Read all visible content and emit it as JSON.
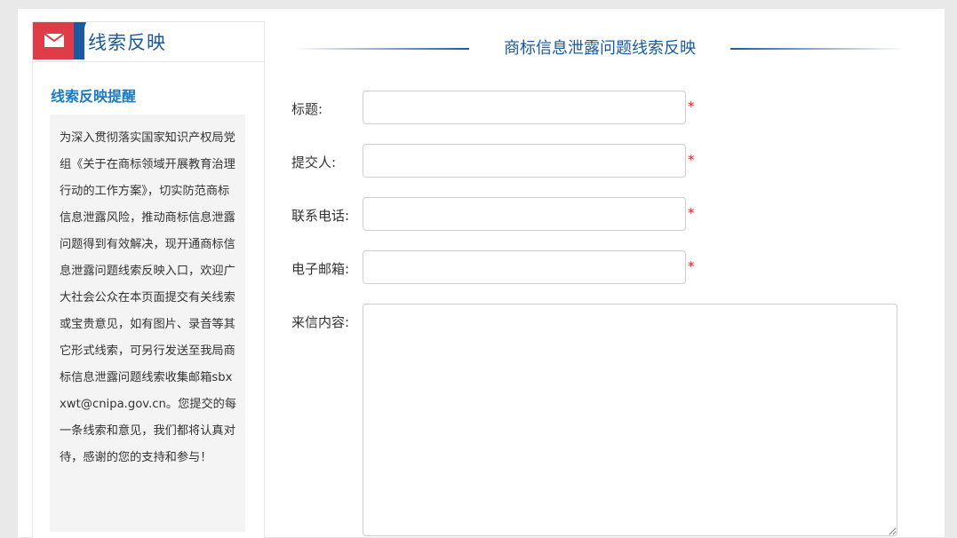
{
  "sidebar": {
    "header_title": "线索反映",
    "subtitle": "线索反映提醒",
    "notice_text": "为深入贯彻落实国家知识产权局党组《关于在商标领域开展教育治理行动的工作方案》，切实防范商标信息泄露风险，推动商标信息泄露问题得到有效解决，现开通商标信息泄露问题线索反映入口，欢迎广大社会公众在本页面提交有关线索或宝贵意见，如有图片、录音等其它形式线索，可另行发送至我局商标信息泄露问题线索收集邮箱sbxxwt@cnipa.gov.cn。您提交的每一条线索和意见，我们都将认真对待，感谢的您的支持和参与！"
  },
  "main": {
    "title": "商标信息泄露问题线索反映",
    "fields": [
      {
        "label": "标题:",
        "value": "",
        "required_mark": "*"
      },
      {
        "label": "提交人:",
        "value": "",
        "required_mark": "*"
      },
      {
        "label": "联系电话:",
        "value": "",
        "required_mark": "*"
      },
      {
        "label": "电子邮箱:",
        "value": "",
        "required_mark": "*"
      }
    ],
    "content": {
      "label": "来信内容:",
      "value": ""
    }
  },
  "colors": {
    "accent_blue": "#1a5aa0",
    "link_blue": "#1a7bc0",
    "badge_red": "#e03c47",
    "required_red": "#e02020"
  },
  "icons": {
    "header_badge": "mail-icon"
  }
}
